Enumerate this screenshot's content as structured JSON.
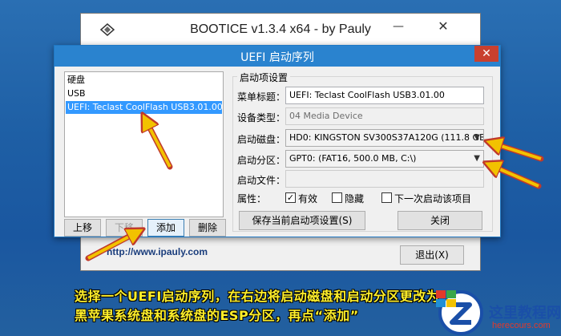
{
  "background_window": {
    "title": "BOOTICE v1.3.4 x64 - by Pauly",
    "url_text": "http://www.ipauly.com",
    "exit_button": "退出(X)"
  },
  "dialog": {
    "title": "UEFI 启动序列",
    "close_glyph": "✕",
    "boot_list": [
      {
        "label": "硬盘",
        "selected": false
      },
      {
        "label": "USB",
        "selected": false
      },
      {
        "label": "UEFI: Teclast CoolFlash USB3.01.00",
        "selected": true
      }
    ],
    "buttons": {
      "move_up": "上移",
      "move_down": "下移",
      "add": "添加",
      "delete": "删除",
      "save": "保存当前启动项设置(S)",
      "close": "关闭"
    },
    "settings": {
      "group_title": "启动项设置",
      "menu_title_label": "菜单标题：",
      "menu_title_value": "UEFI: Teclast CoolFlash USB3.01.00",
      "device_type_label": "设备类型：",
      "device_type_value": "04 Media Device",
      "boot_disk_label": "启动磁盘：",
      "boot_disk_value": "HD0: KINGSTON SV300S37A120G (111.8 GB, C",
      "boot_partition_label": "启动分区：",
      "boot_partition_value": "GPT0: (FAT16, 500.0 MB, C:\\)",
      "boot_file_label": "启动文件：",
      "boot_file_value": "",
      "attributes_label": "属性：",
      "attr_active": {
        "label": "有效",
        "checked": true
      },
      "attr_hidden": {
        "label": "隐藏",
        "checked": false
      },
      "attr_next_boot": {
        "label": "下一次启动该项目",
        "checked": false
      }
    }
  },
  "caption": {
    "line1": "选择一个UEFI启动序列，在右边将启动磁盘和启动分区更改为",
    "line2": "黑苹果系统盘和系统盘的ESP分区，再点“添加”"
  },
  "watermark": {
    "site_name": "这里教程网",
    "site_url": "herecours.com"
  },
  "colors": {
    "accent_titlebar": "#2a83cf",
    "close_red": "#c9402e",
    "selection_blue": "#3399ff",
    "annotation_arrow": "#e8b400",
    "caption_text": "#ffef2a"
  }
}
